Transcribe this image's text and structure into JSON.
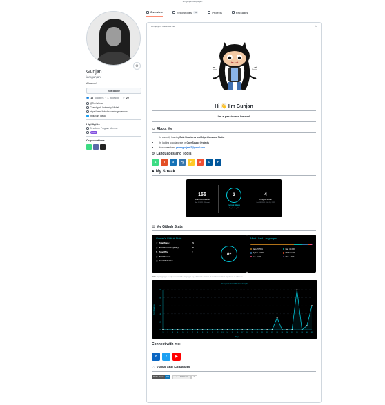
{
  "topline": "iamgunjan/iamgunjan",
  "tabs": [
    {
      "label": "Overview",
      "count": ""
    },
    {
      "label": "Repositories",
      "count": "36"
    },
    {
      "label": "Projects",
      "count": ""
    },
    {
      "label": "Packages",
      "count": ""
    }
  ],
  "profile": {
    "name": "Gunjan",
    "username": "iamgunjan",
    "bio": "A learner!",
    "edit_label": "Edit profile",
    "followers_count": "13",
    "followers_label": "followers",
    "following_count": "1",
    "following_label": "following",
    "stars": "29",
    "vcard": [
      {
        "icon": "at-icon",
        "text": "@TechsHead"
      },
      {
        "icon": "location-icon",
        "text": "Chandigarh University, Mohali"
      },
      {
        "icon": "link-icon",
        "text": "https://www.linkedin.com/in/gunjanpan..."
      },
      {
        "icon": "twitter-icon",
        "text": "@gunjan_pawar"
      }
    ],
    "highlights_heading": "Highlights",
    "highlight_item": "Developer Program Member",
    "pro_label": "PRO",
    "orgs_heading": "Organizations"
  },
  "readme": {
    "path": "iamgunjan / README.md",
    "greeting": "Hi 👋 I'm Gunjan",
    "tagline": "I'm a passionate learner!",
    "about_heading": "About Me",
    "about_items": [
      {
        "prefix": "I'm currently learning ",
        "bold": "Data Structures and Algorithms and Flutter",
        "suffix": ""
      },
      {
        "prefix": "I'm looking to collaborate on ",
        "bold": "OpenSource Projects",
        "suffix": ""
      },
      {
        "prefix": "How to reach me ",
        "bold": "pawargunjan07@gmail.com",
        "suffix": ""
      }
    ],
    "langs_heading": "Languages and Tools:",
    "langs": [
      {
        "label": "A",
        "color": "#3ddc84",
        "name": "android-icon"
      },
      {
        "label": "5",
        "color": "#e34f26",
        "name": "html5-icon"
      },
      {
        "label": "3",
        "color": "#1572b6",
        "name": "css3-icon"
      },
      {
        "label": "Py",
        "color": "#3776ab",
        "name": "python-icon"
      },
      {
        "label": "F",
        "color": "#ffca28",
        "name": "firebase-icon"
      },
      {
        "label": "G",
        "color": "#f05032",
        "name": "git-icon"
      },
      {
        "label": "C",
        "color": "#00599c",
        "name": "cplusplus-icon"
      },
      {
        "label": "F",
        "color": "#02569b",
        "name": "flutter-icon"
      }
    ],
    "streak_heading": "My Streak",
    "streak": {
      "total": "155",
      "total_label": "Total Contributions",
      "total_range": "Aug 1, 2021 - Present",
      "current": "3",
      "current_label": "Current Streak",
      "current_range": "Aug 9 - Aug 11",
      "longest": "4",
      "longest_label": "Longest Streak",
      "longest_range": "Oct 13, 2021 - Oct 16, 2021"
    },
    "stats_heading": "My Github Stats",
    "stats_title": "Gunjan's GitHub Stats",
    "stats": [
      {
        "k": "Total Stars:",
        "v": "29"
      },
      {
        "k": "Total Commits (2021):",
        "v": "85"
      },
      {
        "k": "Total PRs:",
        "v": "2"
      },
      {
        "k": "Total Issues:",
        "v": "1"
      },
      {
        "k": "Contributed to:",
        "v": "1"
      }
    ],
    "grade": "A+",
    "langs_card_title": "Most Used Languages",
    "used_langs": [
      {
        "name": "Java",
        "pct": "70.55%",
        "color": "#b07219"
      },
      {
        "name": "Dart",
        "pct": "12.68%",
        "color": "#00b4ab"
      },
      {
        "name": "Python",
        "pct": "9.93%",
        "color": "#3572a5"
      },
      {
        "name": "HTML",
        "pct": "3.32%",
        "color": "#e34c26"
      },
      {
        "name": "C++",
        "pct": "2.12%",
        "color": "#f34b7d"
      },
      {
        "name": "CSS",
        "pct": "1.40%",
        "color": "#563d7c"
      }
    ],
    "note_bold": "Note:",
    "note_text": "Top languages is only a metric of the languages my public code consists of and doesn't reflect experience or skill level.",
    "graph_title": "Gunjan's Contribution Graph",
    "connect_heading": "Connect with me:",
    "views_heading": "Views and Followers",
    "profile_views_label": "Profile views",
    "profile_views_value": "203",
    "followers_badge_label": "Followers",
    "followers_badge_value": "13"
  },
  "chart_data": {
    "type": "line",
    "title": "Gunjan's Contribution Graph",
    "xlabel": "Days",
    "ylabel": "Contributions",
    "x": [
      1,
      2,
      3,
      4,
      5,
      6,
      7,
      8,
      9,
      10,
      11,
      12,
      13,
      14,
      15,
      16,
      17,
      18,
      19,
      20,
      21,
      22,
      23,
      24,
      25,
      26,
      27,
      28,
      29,
      30,
      31
    ],
    "values": [
      0,
      0,
      0,
      0,
      0,
      0,
      0,
      0,
      0,
      0,
      0,
      0,
      0,
      0,
      0,
      0,
      0,
      0,
      0,
      0,
      0,
      0,
      0,
      3,
      0,
      0,
      0,
      10,
      0,
      1,
      6
    ],
    "ylim": [
      0,
      10
    ]
  }
}
